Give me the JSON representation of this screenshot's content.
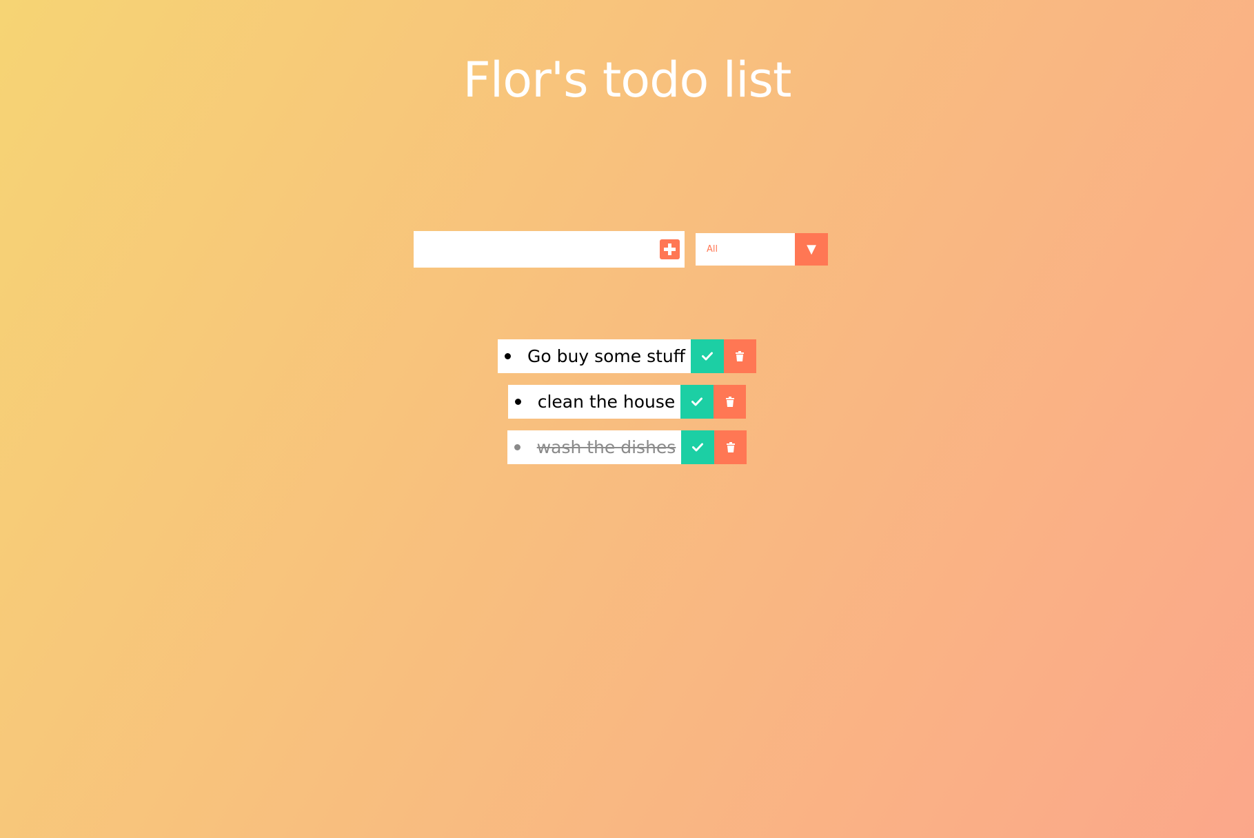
{
  "header": {
    "title": "Flor's todo list"
  },
  "form": {
    "input_value": "",
    "add_icon": "plus-icon",
    "filter": {
      "selected": "All",
      "arrow_icon": "triangle-down-icon"
    }
  },
  "todos": [
    {
      "text": "Go buy some stuff",
      "completed": false
    },
    {
      "text": "clean the house",
      "completed": false
    },
    {
      "text": "wash the dishes",
      "completed": true
    }
  ],
  "colors": {
    "accent": "#ff7754",
    "complete": "#1ccfa4",
    "background_start": "#f6d474",
    "background_end": "#fba78a"
  }
}
